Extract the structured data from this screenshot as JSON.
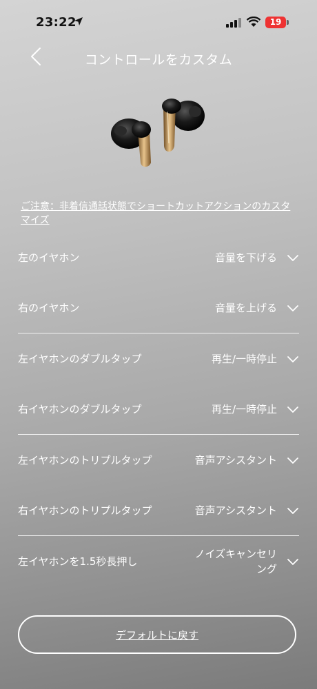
{
  "status": {
    "time": "23:22",
    "battery": "19"
  },
  "nav": {
    "title": "コントロールをカスタム"
  },
  "notice": "ご注意：非着信通話状態でショートカットアクションのカスタマイズ",
  "rows": [
    {
      "label": "左のイヤホン",
      "value": "音量を下げる"
    },
    {
      "label": "右のイヤホン",
      "value": "音量を上げる"
    },
    {
      "label": "左イヤホンのダブルタップ",
      "value": "再生/一時停止"
    },
    {
      "label": "右イヤホンのダブルタップ",
      "value": "再生/一時停止"
    },
    {
      "label": "左イヤホンのトリプルタップ",
      "value": "音声アシスタント"
    },
    {
      "label": "右イヤホンのトリプルタップ",
      "value": "音声アシスタント"
    },
    {
      "label": "左イヤホンを1.5秒長押し",
      "value": "ノイズキャンセリング"
    }
  ],
  "reset_label": "デフォルトに戻す"
}
